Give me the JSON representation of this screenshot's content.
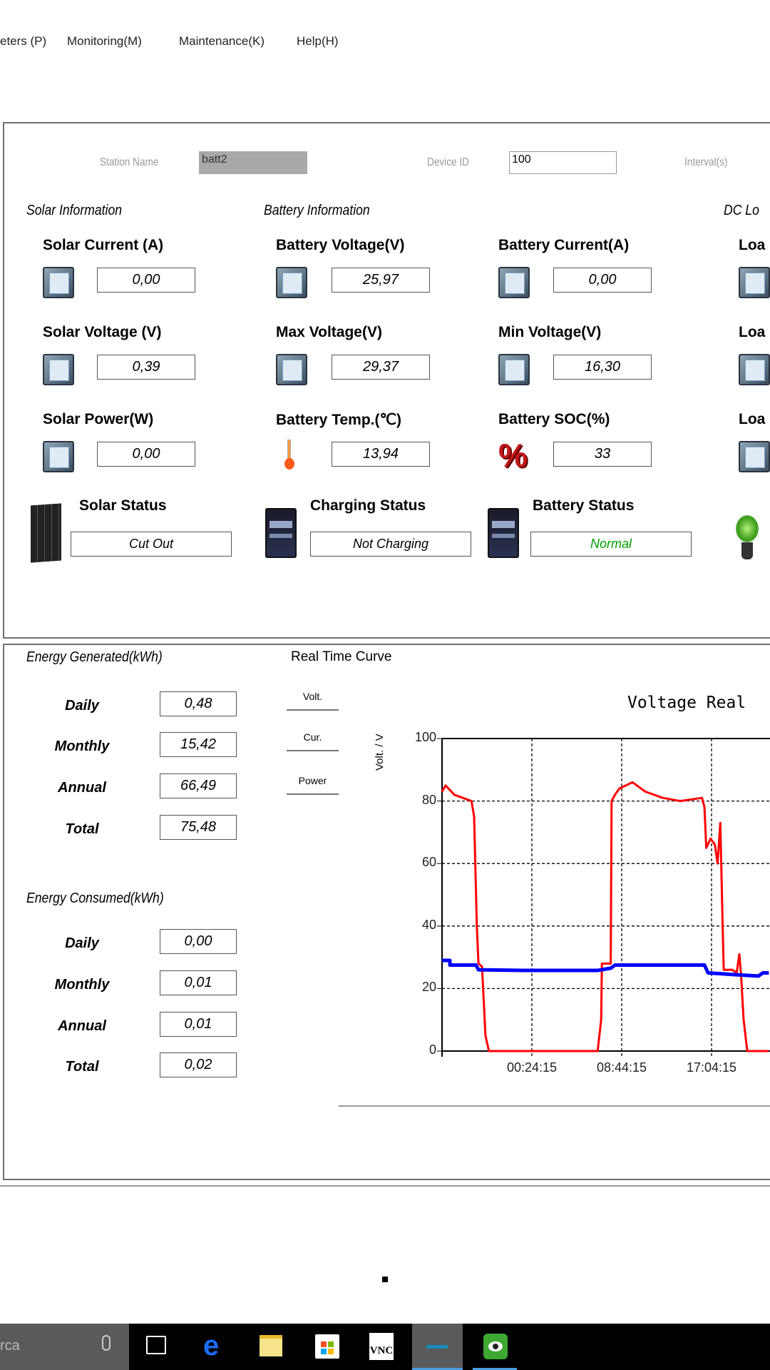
{
  "menu": [
    "eters (P)",
    "Monitoring(M)",
    "Maintenance(K)",
    "Help(H)"
  ],
  "config": {
    "station_label": "Station Name",
    "station_value": "batt2",
    "device_label": "Device ID",
    "device_value": "100",
    "interval_label": "Interval(s)"
  },
  "sections": {
    "solar": "Solar Information",
    "battery": "Battery Information",
    "load": "DC Lo"
  },
  "readings": [
    {
      "label": "Solar Current (A)",
      "value": "0,00",
      "icon": "meter-icon"
    },
    {
      "label": "Battery Voltage(V)",
      "value": "25,97",
      "icon": "meter-icon"
    },
    {
      "label": "Battery Current(A)",
      "value": "0,00",
      "icon": "meter-icon"
    },
    {
      "label": "Loa",
      "icon": "meter-icon"
    },
    {
      "label": "Solar Voltage (V)",
      "value": "0,39",
      "icon": "meter-icon"
    },
    {
      "label": "Max Voltage(V)",
      "value": "29,37",
      "icon": "meter-icon"
    },
    {
      "label": "Min Voltage(V)",
      "value": "16,30",
      "icon": "meter-icon"
    },
    {
      "label": "Loa",
      "icon": "meter-icon"
    },
    {
      "label": "Solar Power(W)",
      "value": "0,00",
      "icon": "meter-icon"
    },
    {
      "label": "Battery Temp.(℃)",
      "value": "13,94",
      "icon": "thermometer-icon"
    },
    {
      "label": "Battery SOC(%)",
      "value": "33",
      "icon": "percent-icon"
    },
    {
      "label": "Loa",
      "icon": "meter-icon"
    }
  ],
  "status": [
    {
      "label": "Solar Status",
      "value": "Cut Out",
      "color": "#000000",
      "icon": "solar-panel-icon"
    },
    {
      "label": "Charging Status",
      "value": "Not Charging",
      "color": "#000000",
      "icon": "battery-icon"
    },
    {
      "label": "Battery Status",
      "value": "Normal",
      "color": "#00a000",
      "icon": "battery-icon"
    }
  ],
  "energy_generated": {
    "title": "Energy Generated(kWh)",
    "rows": [
      {
        "label": "Daily",
        "value": "0,48"
      },
      {
        "label": "Monthly",
        "value": "15,42"
      },
      {
        "label": "Annual",
        "value": "66,49"
      },
      {
        "label": "Total",
        "value": "75,48"
      }
    ]
  },
  "energy_consumed": {
    "title": "Energy Consumed(kWh)",
    "rows": [
      {
        "label": "Daily",
        "value": "0,00"
      },
      {
        "label": "Monthly",
        "value": "0,01"
      },
      {
        "label": "Annual",
        "value": "0,01"
      },
      {
        "label": "Total",
        "value": "0,02"
      }
    ]
  },
  "curve": {
    "title": "Real Time Curve",
    "buttons": [
      "Volt.",
      "Cur.",
      "Power"
    ]
  },
  "chart_data": {
    "type": "line",
    "title": "Voltage Real",
    "ylabel": "Volt. / V",
    "xlabel": "",
    "ylim": [
      0,
      100
    ],
    "yticks": [
      0,
      20,
      40,
      60,
      80,
      100
    ],
    "xstart": "16:04:15",
    "xticks": [
      "00:24:15",
      "08:44:15",
      "17:04:15"
    ],
    "grid": true,
    "series": [
      {
        "color": "#ff0000",
        "points": [
          [
            "16:04",
            83
          ],
          [
            "16:24",
            85
          ],
          [
            "17:12",
            82
          ],
          [
            "18:00",
            81
          ],
          [
            "18:48",
            80
          ],
          [
            "19:03",
            75
          ],
          [
            "19:18",
            40
          ],
          [
            "19:27",
            28
          ],
          [
            "19:47",
            27
          ],
          [
            "20:06",
            5
          ],
          [
            "20:25",
            0
          ],
          [
            "06:30",
            0
          ],
          [
            "06:50",
            10
          ],
          [
            "06:54",
            28
          ],
          [
            "07:43",
            28
          ],
          [
            "07:48",
            80
          ],
          [
            "08:07",
            82
          ],
          [
            "08:31",
            84
          ],
          [
            "09:44",
            86
          ],
          [
            "10:56",
            83
          ],
          [
            "12:33",
            81
          ],
          [
            "14:10",
            80
          ],
          [
            "16:11",
            81
          ],
          [
            "16:25",
            78
          ],
          [
            "16:35",
            65
          ],
          [
            "16:59",
            68
          ],
          [
            "17:23",
            66
          ],
          [
            "17:38",
            60
          ],
          [
            "17:53",
            73
          ],
          [
            "18:07",
            38
          ],
          [
            "18:12",
            26
          ],
          [
            "19:00",
            26
          ],
          [
            "19:24",
            25
          ],
          [
            "19:39",
            31
          ],
          [
            "19:49",
            24
          ],
          [
            "20:03",
            10
          ],
          [
            "20:23",
            0
          ],
          [
            "22:23",
            0
          ]
        ]
      },
      {
        "color": "#0000ff",
        "points": [
          [
            "16:04",
            29
          ],
          [
            "16:48",
            29
          ],
          [
            "16:48",
            27.5
          ],
          [
            "19:13",
            27.5
          ],
          [
            "19:27",
            26
          ],
          [
            "23:39",
            25.8
          ],
          [
            "06:30",
            25.8
          ],
          [
            "07:43",
            26.5
          ],
          [
            "08:07",
            27.5
          ],
          [
            "16:25",
            27.5
          ],
          [
            "16:45",
            25
          ],
          [
            "19:00",
            24.5
          ],
          [
            "21:25",
            24
          ],
          [
            "21:50",
            25
          ],
          [
            "22:23",
            25
          ]
        ]
      }
    ]
  },
  "taskbar": {
    "search_text": "rca",
    "icons": [
      "microphone-icon",
      "task-view-icon",
      "edge-icon",
      "file-explorer-icon",
      "store-icon",
      "vnc-icon",
      "app-icon",
      "eye-app-icon"
    ]
  }
}
